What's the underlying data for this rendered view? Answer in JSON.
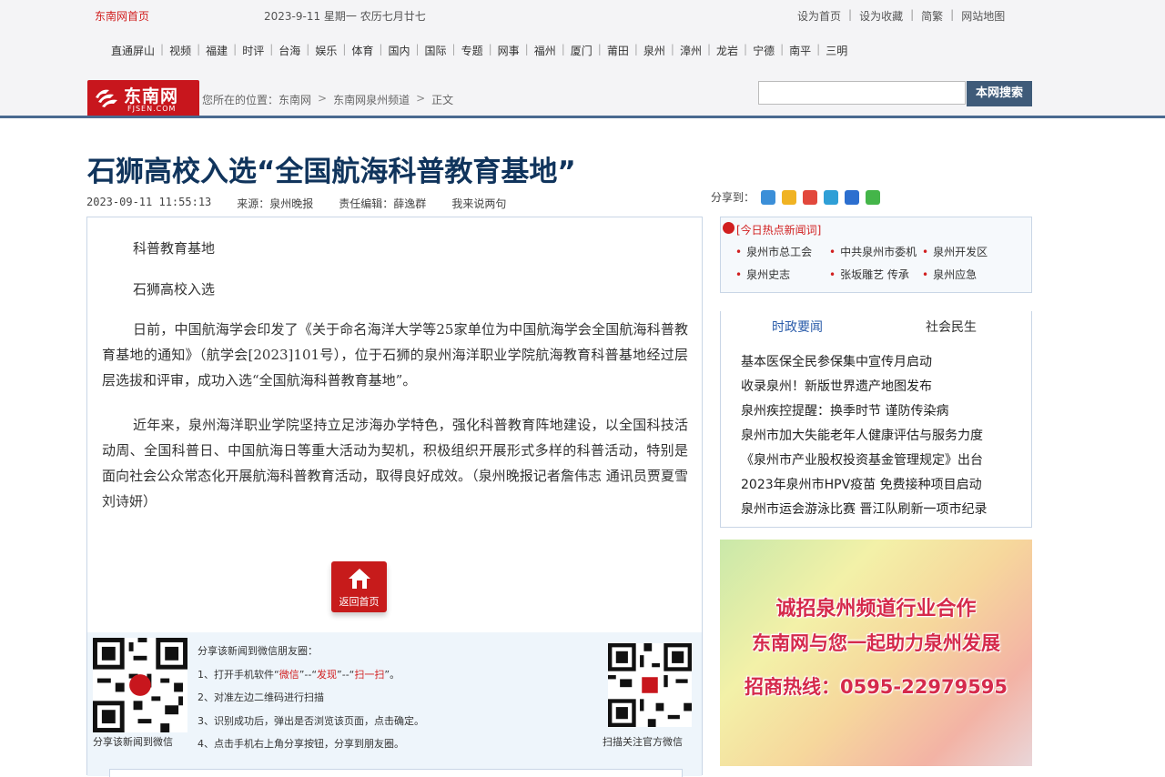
{
  "topbar": {
    "site_home": "东南网首页",
    "date": "2023-9-11  星期一  农历七月廿七",
    "links": [
      "设为首页",
      "设为收藏",
      "简繁",
      "网站地图"
    ]
  },
  "nav": [
    "直通屏山",
    "视频",
    "福建",
    "时评",
    "台海",
    "娱乐",
    "体育",
    "国内",
    "国际",
    "专题",
    "网事",
    "福州",
    "厦门",
    "莆田",
    "泉州",
    "漳州",
    "龙岩",
    "宁德",
    "南平",
    "三明"
  ],
  "logo": {
    "name": "东南网",
    "domain": "FJSEN.COM"
  },
  "breadcrumb": {
    "prefix": "您所在的位置：",
    "items": [
      "东南网",
      "东南网泉州频道",
      "正文"
    ]
  },
  "search": {
    "placeholder": "",
    "button": "本网搜索"
  },
  "article": {
    "title": "石狮高校入选“全国航海科普教育基地”",
    "datetime": "2023-09-11 11:55:13",
    "source": "来源：泉州晚报",
    "editor": "责任编辑：薛逸群",
    "comment": "我来说两句",
    "paragraphs": [
      "科普教育基地",
      "石狮高校入选",
      "日前，中国航海学会印发了《关于命名海洋大学等25家单位为中国航海学会全国航海科普教育基地的通知》（航学会[2023]101号），位于石狮的泉州海洋职业学院航海教育科普基地经过层层选拔和评审，成功入选“全国航海科普教育基地”。",
      "近年来，泉州海洋职业学院坚持立足涉海办学特色，强化科普教育阵地建设，以全国科技活动周、全国科普日、中国航海日等重大活动为契机，积极组织开展形式多样的科普活动，特别是面向社会公众常态化开展航海科普教育活动，取得良好成效。（泉州晚报记者詹伟志 通讯员贾夏雪 刘诗妍）"
    ],
    "home_button": "返回首页"
  },
  "share": {
    "label": "分享到："
  },
  "wechat": {
    "line0": "分享该新闻到微信朋友圈：",
    "line1_a": "1、打开手机软件“",
    "line1_b": "微信",
    "line1_c": "”--“",
    "line1_d": "发现",
    "line1_e": "”--“",
    "line1_f": "扫一扫",
    "line1_g": "”。",
    "line2": "2、对准左边二维码进行扫描",
    "line3": "3、识别成功后，弹出是否浏览该页面，点击确定。",
    "line4": "4、点击手机右上角分享按钮，分享到朋友圈。",
    "qr_left_caption": "分享该新闻到微信",
    "qr_right_caption": "扫描关注官方微信"
  },
  "hot": {
    "title": "[今日热点新闻词]",
    "items": [
      "泉州市总工会",
      "中共泉州市委机",
      "泉州开发区",
      "泉州史志",
      "张坂雕艺 传承",
      "泉州应急"
    ]
  },
  "news_tabs": {
    "tabs": [
      "时政要闻",
      "社会民生"
    ],
    "items": [
      "基本医保全民参保集中宣传月启动",
      "收录泉州！新版世界遗产地图发布",
      "泉州疾控提醒：换季时节 谨防传染病",
      "泉州市加大失能老年人健康评估与服务力度",
      "《泉州市产业股权投资基金管理规定》出台",
      "2023年泉州市HPV疫苗 免费接种项目启动",
      "泉州市运会游泳比赛 晋江队刷新一项市纪录"
    ]
  },
  "ad": {
    "line1": "诚招泉州频道行业合作",
    "line2": "东南网与您一起助力泉州发展",
    "line3": "招商热线：0595-22979595"
  },
  "colors": {
    "brand_red": "#c8161d",
    "title_blue": "#10345c",
    "divider": "#4a6a90"
  }
}
